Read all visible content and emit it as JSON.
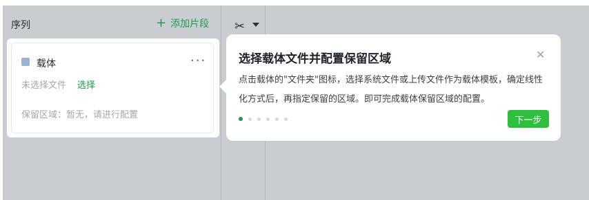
{
  "sequence_panel": {
    "title": "序列",
    "add_segment_icon": "plus-icon",
    "add_segment_label": "添加片段"
  },
  "toolbar": {
    "scissors_icon": "scissors-icon",
    "dropdown_icon": "chevron-down-icon"
  },
  "card": {
    "carrier_label": "载体",
    "more_icon": "more-icon",
    "no_file_text": "未选择文件",
    "select_link": "选择",
    "retain_region_text": "保留区域：暂无，请进行配置"
  },
  "tooltip": {
    "title": "选择载体文件并配置保留区域",
    "close_icon": "close-icon",
    "body": "点击载体的\"文件夹\"图标，选择系统文件或上传文件作为载体模板，确定线性化方式后，再指定保留的区域。即可完成载体保留区域的配置。",
    "step_total": 6,
    "step_current": 1,
    "next_label": "下一步"
  },
  "colors": {
    "accent_green": "#1e9b4a",
    "button_green": "#2fbf3f",
    "background_gray": "#c9cdd1"
  }
}
